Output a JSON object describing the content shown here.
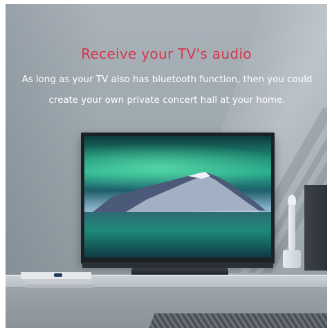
{
  "headline": "Receive your TV's audio",
  "subtext": "As long as your TV also has bluetooth function, then you could\ncreate your own private concert hall at your home.",
  "colors": {
    "headline": "#d8354a",
    "subtext": "#ffffff"
  }
}
